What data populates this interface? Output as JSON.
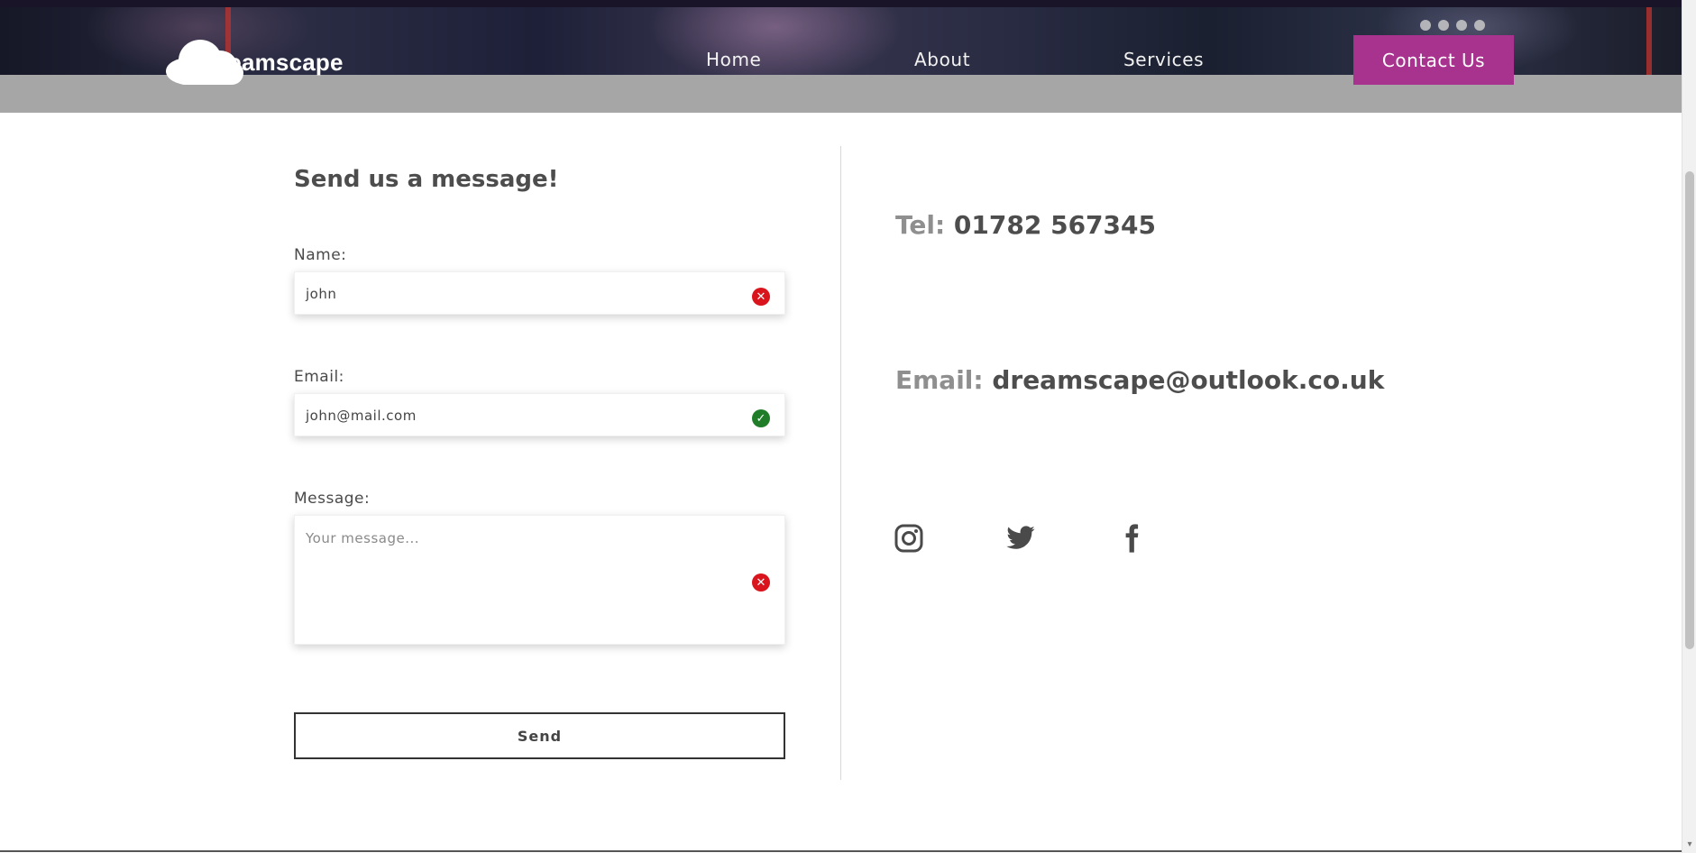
{
  "brand": {
    "name": "Dreamscape"
  },
  "nav": {
    "items": [
      {
        "label": "Home"
      },
      {
        "label": "About"
      },
      {
        "label": "Services"
      }
    ],
    "cta_label": "Contact Us"
  },
  "form": {
    "title": "Send us a message!",
    "name": {
      "label": "Name:",
      "value": "john",
      "status": "invalid"
    },
    "email": {
      "label": "Email:",
      "value": "john@mail.com",
      "status": "valid"
    },
    "message": {
      "label": "Message:",
      "placeholder": "Your message...",
      "status": "invalid"
    },
    "send_label": "Send"
  },
  "contact": {
    "tel_label": "Tel:",
    "tel_value": "01782 567345",
    "email_label": "Email:",
    "email_value": "dreamscape@outlook.co.uk"
  },
  "social": [
    {
      "icon": "instagram-icon"
    },
    {
      "icon": "twitter-icon"
    },
    {
      "icon": "facebook-icon"
    }
  ],
  "colors": {
    "accent": "#a8338f",
    "error": "#d9141c",
    "success": "#1f7d2a",
    "muted_label": "#8f8f8f",
    "text": "#4d4d4d"
  }
}
